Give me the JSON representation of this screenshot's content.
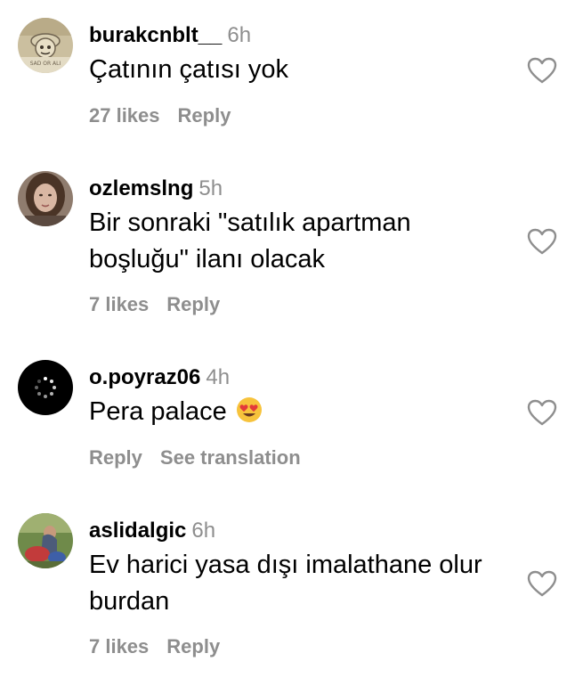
{
  "comments": [
    {
      "username": "burakcnblt__",
      "time": "6h",
      "text": "Çatının çatısı yok",
      "likes": "27 likes",
      "reply": "Reply",
      "avatar_watermark": "SAD OR ALI",
      "avatar_icon": "pirate-skull-avatar"
    },
    {
      "username": "ozlemslng",
      "time": "5h",
      "text": "Bir sonraki \"satılık apartman boşluğu\" ilanı olacak",
      "likes": "7 likes",
      "reply": "Reply",
      "avatar_icon": "woman-photo-avatar"
    },
    {
      "username": "o.poyraz06",
      "time": "4h",
      "text": "Pera palace",
      "emoji": "heart-eyes-emoji",
      "reply": "Reply",
      "see_translation": "See translation",
      "avatar_icon": "loading-spinner-avatar"
    },
    {
      "username": "aslidalgic",
      "time": "6h",
      "text": "Ev harici yasa dışı imalathane olur burdan",
      "likes": "7 likes",
      "reply": "Reply",
      "avatar_icon": "outdoor-photo-avatar"
    }
  ],
  "colors": {
    "text": "#000000",
    "muted": "#8e8e8e",
    "heart_outline": "#8e8e8e"
  },
  "icons": {
    "like": "heart-outline-icon"
  }
}
